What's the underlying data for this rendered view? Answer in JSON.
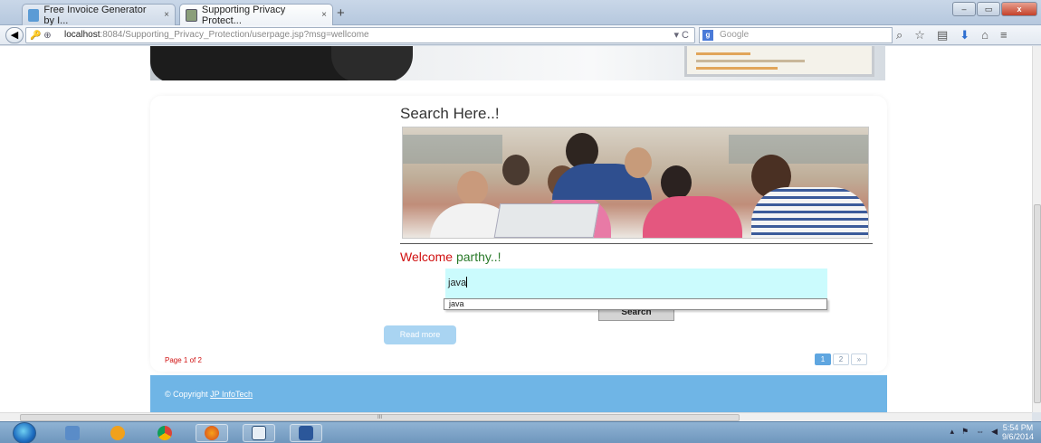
{
  "browser": {
    "tabs": [
      {
        "title": "Free Invoice Generator by I...",
        "close": "×"
      },
      {
        "title": "Supporting Privacy Protect...",
        "close": "×"
      }
    ],
    "new_tab": "+",
    "window_buttons": [
      "–",
      "▭",
      "x"
    ],
    "url_host": "localhost",
    "url_rest": ":8084/Supporting_Privacy_Protection/userpage.jsp?msg=wellcome",
    "reload": "▾ C",
    "search_placeholder": "Google",
    "search_engine_letter": "g",
    "toolbar_icons": [
      "⌕",
      "☆",
      "▤",
      "⬇",
      "⌂",
      "≡"
    ]
  },
  "page": {
    "heading": "Search Here..!",
    "welcome_label": "Welcome",
    "welcome_user": "parthy..!",
    "search_value": "java",
    "autocomplete_option": "java",
    "search_button": "Search",
    "read_more": "Read more",
    "page_info": "Page 1 of 2",
    "pagination": [
      "1",
      "2",
      "»"
    ],
    "footer_prefix": "© Copyright",
    "footer_link": "JP InfoTech"
  },
  "scrollbar": {
    "h_grip": "III"
  },
  "taskbar": {
    "time": "5:54 PM",
    "date": "9/6/2014",
    "tray_icons": [
      "▴",
      "⚑",
      "⇔",
      "◀"
    ],
    "apps": [
      "explorer",
      "media-player",
      "chrome",
      "firefox",
      "virtualbox",
      "word"
    ]
  },
  "colors": {
    "search_field_bg": "#cbfbfd",
    "welcome_red": "#d01010",
    "welcome_green": "#2a7a2a",
    "footer_blue": "#6fb5e6",
    "read_more_bg": "#a9d4f2",
    "pager_active": "#5fa6e0"
  }
}
